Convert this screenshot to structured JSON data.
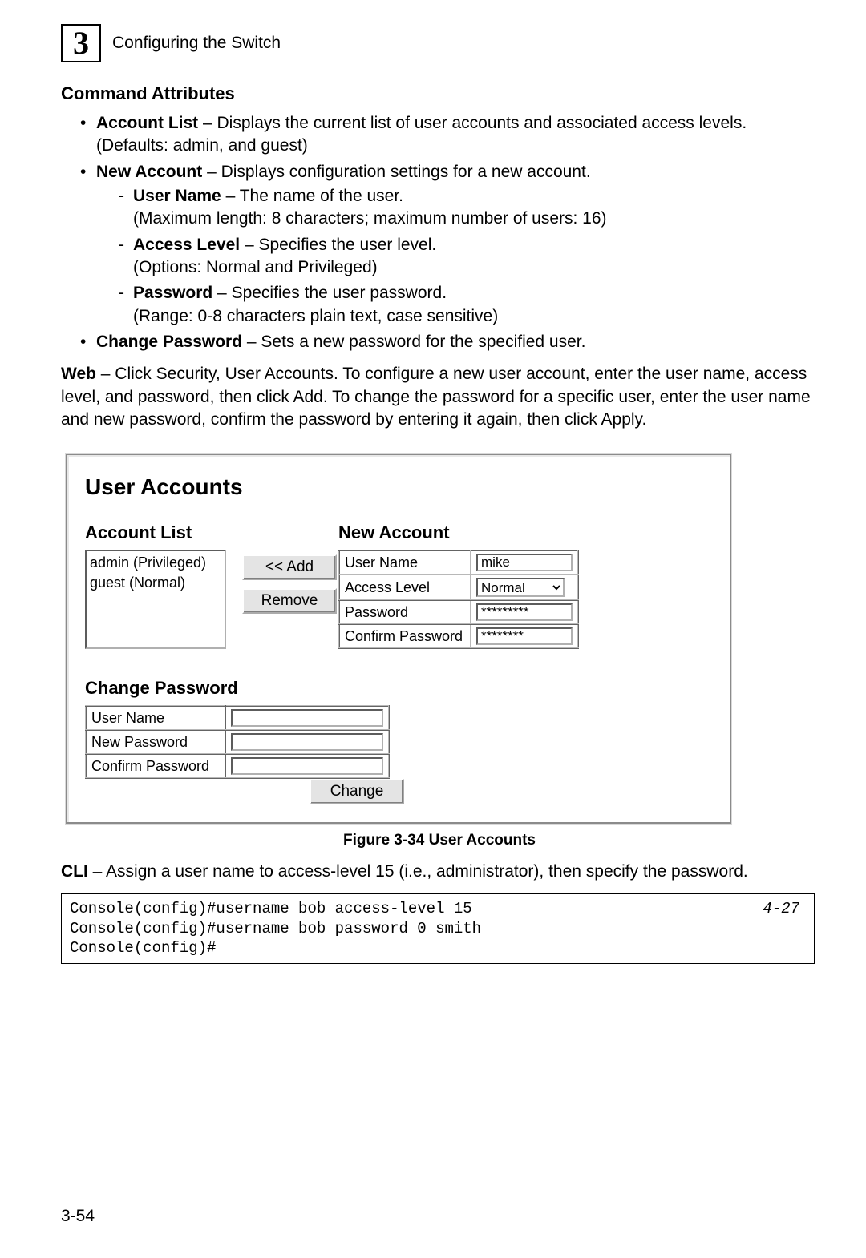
{
  "chapter": {
    "number": "3",
    "title": "Configuring the Switch"
  },
  "section_heading": "Command Attributes",
  "bullets": {
    "account_list_label": "Account List",
    "account_list_text": " – Displays the current list of user accounts and associated access levels. (Defaults: admin, and guest)",
    "new_account_label": "New Account",
    "new_account_text": " – Displays configuration settings for a new account.",
    "user_name_label": "User Name",
    "user_name_text": " – The name of the user.",
    "user_name_line2": "(Maximum length: 8 characters; maximum number of users: 16)",
    "access_level_label": "Access Level",
    "access_level_text": " – Specifies the user level.",
    "access_level_line2": "(Options: Normal and Privileged)",
    "password_label": "Password",
    "password_text": " – Specifies the user password.",
    "password_line2": "(Range: 0-8 characters plain text, case sensitive)",
    "change_password_label": "Change Password",
    "change_password_text": " – Sets a new password for the specified user."
  },
  "web_para": {
    "prefix": "Web",
    "text": " – Click Security, User Accounts. To configure a new user account, enter the user name, access level, and password, then click Add. To change the password for a specific user, enter the user name and new password, confirm the password by entering it again, then click Apply."
  },
  "figure": {
    "panel_title": "User Accounts",
    "account_list_heading": "Account List",
    "account_list_items": [
      "admin (Privileged)",
      "guest (Normal)"
    ],
    "add_button": "<< Add",
    "remove_button": "Remove",
    "new_account_heading": "New Account",
    "na_user_name_label": "User Name",
    "na_user_name_value": "mike",
    "na_access_level_label": "Access Level",
    "na_access_level_value": "Normal",
    "na_password_label": "Password",
    "na_password_value": "*********",
    "na_confirm_label": "Confirm Password",
    "na_confirm_value": "********",
    "cp_heading": "Change Password",
    "cp_user_name_label": "User Name",
    "cp_user_name_value": "",
    "cp_new_password_label": "New Password",
    "cp_new_password_value": "",
    "cp_confirm_label": "Confirm Password",
    "cp_confirm_value": "",
    "change_button": "Change",
    "caption": "Figure 3-34   User Accounts"
  },
  "cli_para": {
    "prefix": "CLI",
    "text": " – Assign a user name to access-level 15 (i.e., administrator), then specify the password."
  },
  "cli_box": {
    "line1": "Console(config)#username bob access-level 15",
    "line2": "Console(config)#username bob password 0 smith",
    "line3": "Console(config)#",
    "ref": "4-27"
  },
  "page_number": "3-54"
}
